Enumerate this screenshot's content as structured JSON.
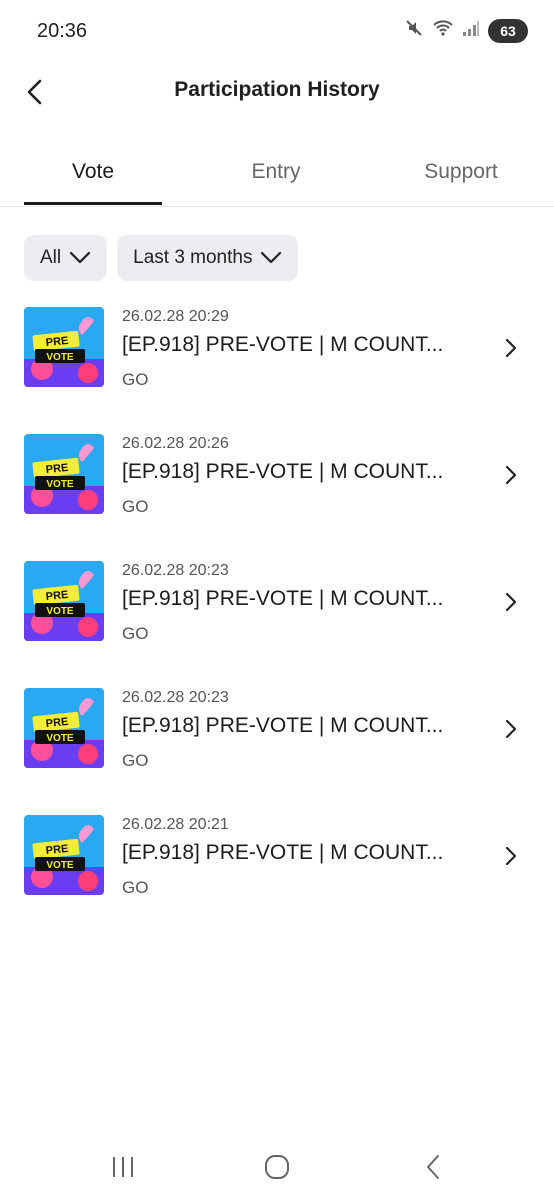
{
  "status_bar": {
    "time": "20:36",
    "battery": "63",
    "icons": [
      "mute-icon",
      "wifi-icon",
      "signal-icon",
      "battery-icon"
    ]
  },
  "header": {
    "title": "Participation History",
    "back_icon": "back-chevron-icon"
  },
  "tabs": [
    {
      "label": "Vote",
      "active": true
    },
    {
      "label": "Entry",
      "active": false
    },
    {
      "label": "Support",
      "active": false
    }
  ],
  "filters": [
    {
      "label": "All"
    },
    {
      "label": "Last 3 months"
    }
  ],
  "items": [
    {
      "thumb_text_top": "PRE",
      "thumb_text_bottom": "VOTE",
      "date": "26.02.28 20:29",
      "title": "[EP.918] PRE-VOTE | M COUNT...",
      "status": "GO"
    },
    {
      "thumb_text_top": "PRE",
      "thumb_text_bottom": "VOTE",
      "date": "26.02.28 20:26",
      "title": "[EP.918] PRE-VOTE | M COUNT...",
      "status": "GO"
    },
    {
      "thumb_text_top": "PRE",
      "thumb_text_bottom": "VOTE",
      "date": "26.02.28 20:23",
      "title": "[EP.918] PRE-VOTE | M COUNT...",
      "status": "GO"
    },
    {
      "thumb_text_top": "PRE",
      "thumb_text_bottom": "VOTE",
      "date": "26.02.28 20:23",
      "title": "[EP.918] PRE-VOTE | M COUNT...",
      "status": "GO"
    },
    {
      "thumb_text_top": "PRE",
      "thumb_text_bottom": "VOTE",
      "date": "26.02.28 20:21",
      "title": "[EP.918] PRE-VOTE | M COUNT...",
      "status": "GO"
    }
  ],
  "nav_bar": {
    "icons": [
      "recent-apps-icon",
      "home-icon",
      "back-icon"
    ]
  },
  "colors": {
    "accent_text": "#1a1a1a",
    "filter_bg": "#ebedf0",
    "thumb_bg": "#2aa8f0",
    "thumb_banner": "#f6ec3a"
  }
}
